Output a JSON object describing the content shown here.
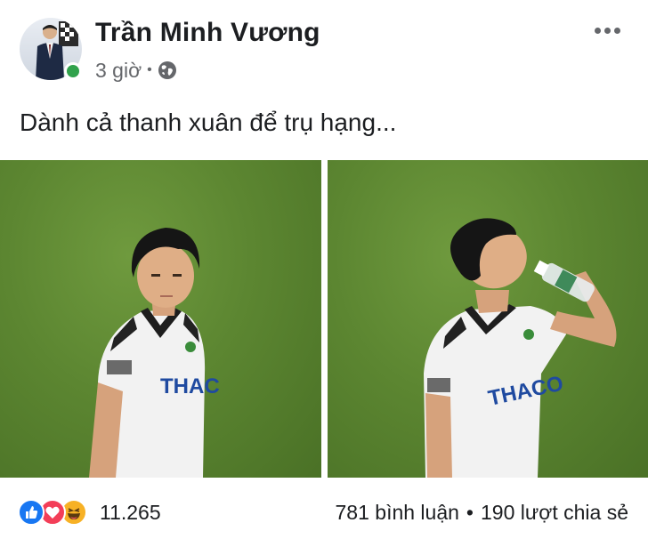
{
  "post": {
    "author_name": "Trần Minh Vương",
    "timestamp": "3 giờ",
    "separator": "•",
    "privacy_icon": "globe-icon",
    "online": true,
    "text": "Dành cả thanh xuân để trụ hạng..."
  },
  "photos": [
    {
      "icon": "photo-player-standing"
    },
    {
      "icon": "photo-player-drinking"
    }
  ],
  "reactions": {
    "types": [
      "like",
      "love",
      "haha"
    ],
    "count": "11.265",
    "comments": "781 bình luận",
    "dot": "•",
    "shares": "190 lượt chia sẻ"
  },
  "colors": {
    "online": "#31a24c",
    "like": "#1877f2",
    "love": "#f33e58",
    "haha": "#f7b125",
    "secondary_text": "#65676b",
    "grass": "#5c8631"
  }
}
